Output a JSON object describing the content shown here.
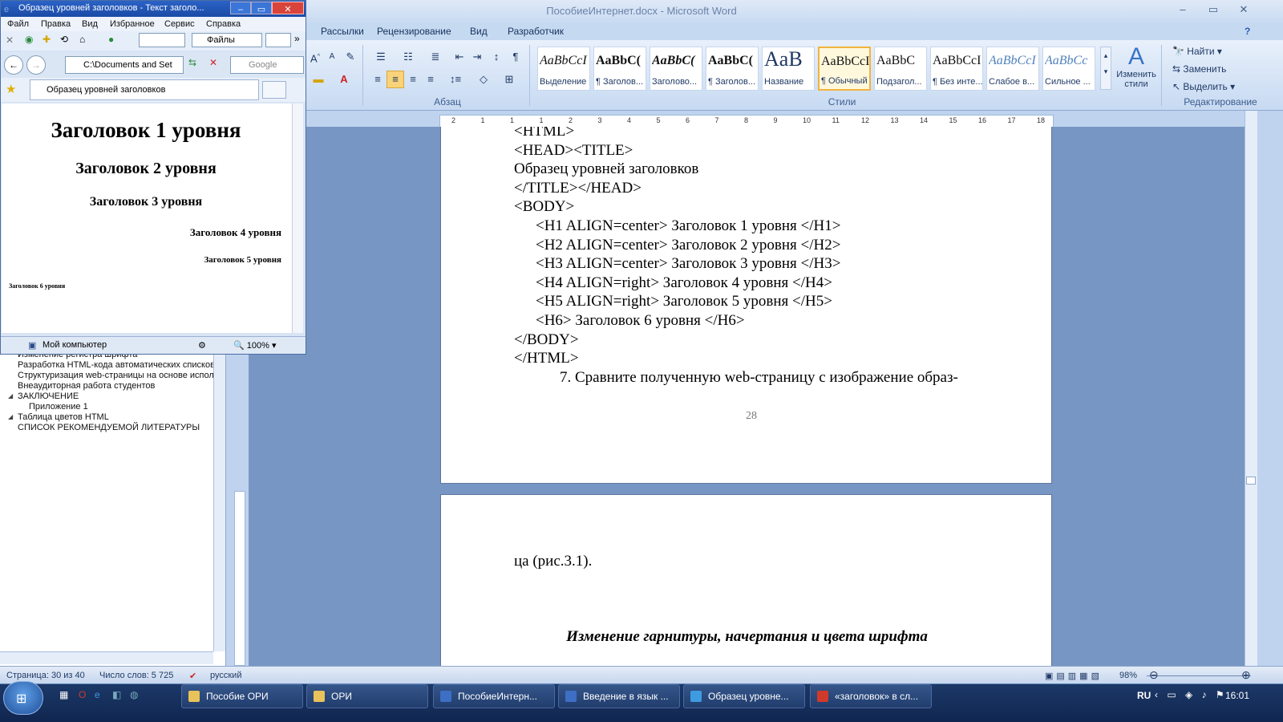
{
  "word": {
    "title": "ПособиеИнтернет.docx - Microsoft Word",
    "window_buttons": [
      "–",
      "▭",
      "✕"
    ],
    "tabs": [
      "Рассылки",
      "Рецензирование",
      "Вид",
      "Разработчик"
    ],
    "groups": {
      "paragraph": "Абзац",
      "styles": "Стили",
      "editing": "Редактирование"
    },
    "styles": [
      {
        "preview": "AaBbCcI",
        "name": "Выделение"
      },
      {
        "preview": "AaBbC(",
        "name": "¶ Заголов..."
      },
      {
        "preview": "AaBbC(",
        "name": "Заголово..."
      },
      {
        "preview": "AaBbC(",
        "name": "¶ Заголов..."
      },
      {
        "preview": "AaB",
        "name": "Название"
      },
      {
        "preview": "AaBbCcI",
        "name": "¶ Обычный"
      },
      {
        "preview": "AaBbC",
        "name": "Подзагол..."
      },
      {
        "preview": "AaBbCcI",
        "name": "¶ Без инте..."
      },
      {
        "preview": "AaBbCcI",
        "name": "Слабое в..."
      },
      {
        "preview": "AaBbCc",
        "name": "Сильное ..."
      }
    ],
    "change_styles": "Изменить стили",
    "editing": {
      "find": "Найти",
      "replace": "Заменить",
      "select": "Выделить"
    },
    "ruler_numbers": [
      "2",
      "1",
      "1",
      "1",
      "2",
      "3",
      "4",
      "5",
      "6",
      "7",
      "8",
      "9",
      "10",
      "11",
      "12",
      "13",
      "14",
      "15",
      "16",
      "17",
      "18"
    ],
    "nav_items": [
      "Изменение регистра шрифта",
      "Разработка HTML-кода автоматических списков",
      "Структуризация web-страницы  на основе испол",
      "Внеаудиторная работа студентов",
      "ЗАКЛЮЧЕНИЕ",
      "Приложение 1",
      "Таблица цветов HTML",
      "СПИСОК РЕКОМЕНДУЕМОЙ ЛИТЕРАТУРЫ"
    ],
    "page1_lines": [
      "<HTML>",
      "<HEAD><TITLE>",
      "Образец уровней заголовков",
      "</TITLE></HEAD>",
      "<BODY>",
      "<H1 ALIGN=center> Заголовок 1 уровня </H1>",
      "<H2 ALIGN=center> Заголовок 2 уровня </H2>",
      "<H3 ALIGN=center> Заголовок 3 уровня </H3>",
      "<H4 ALIGN=right> Заголовок 4 уровня </H4>",
      "<H5 ALIGN=right> Заголовок 5 уровня </H5>",
      "<H6> Заголовок 6 уровня </H6>",
      "</BODY>",
      "</HTML>",
      "7. Сравните полученную web-страницу с изображение образ-"
    ],
    "page_number": "28",
    "page2_line": "ца (рис.3.1).",
    "page2_heading": "Изменение гарнитуры, начертания и цвета шрифта",
    "status": {
      "page": "Страница: 30 из 40",
      "words": "Число слов: 5 725",
      "language": "русский",
      "zoom": "98%"
    }
  },
  "ie": {
    "title": "Образец уровней заголовков - Текст заголо...",
    "menu": [
      "Файл",
      "Правка",
      "Вид",
      "Избранное",
      "Сервис",
      "Справка"
    ],
    "files_label": "Файлы",
    "address": "C:\\Documents and Set",
    "search_placeholder": "Google",
    "tab_title": "Образец уровней заголовков",
    "headings": [
      "Заголовок 1 уровня",
      "Заголовок 2 уровня",
      "Заголовок 3 уровня",
      "Заголовок 4 уровня",
      "Заголовок 5 уровня",
      "Заголовок 6 уровня"
    ],
    "status_zone": "Мой компьютер",
    "zoom": "100%"
  },
  "taskbar": {
    "items": [
      {
        "label": "Пособие ОРИ",
        "color": "#e8c25a"
      },
      {
        "label": "ОРИ",
        "color": "#e8c25a"
      },
      {
        "label": "ПособиеИнтерн...",
        "color": "#3d6fc4"
      },
      {
        "label": "Введение в язык ...",
        "color": "#3d6fc4"
      },
      {
        "label": "Образец уровне...",
        "color": "#3e9be0"
      },
      {
        "label": "«заголовок» в сл...",
        "color": "#d03a2a"
      }
    ],
    "lang": "RU",
    "clock": "16:01"
  }
}
